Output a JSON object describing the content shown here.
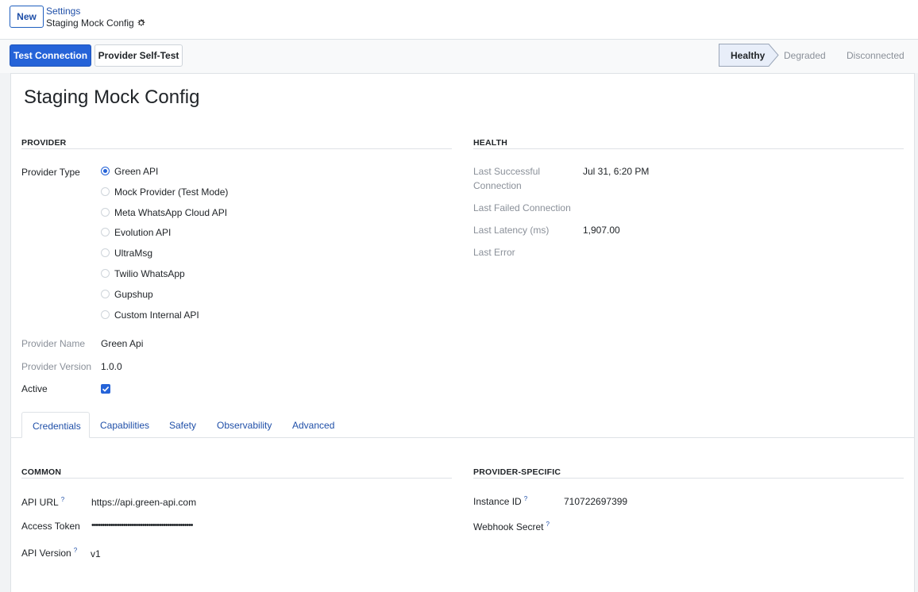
{
  "topbar": {
    "new_label": "New",
    "breadcrumb": "Settings",
    "record_name": "Staging Mock Config"
  },
  "actions": {
    "test_connection": "Test Connection",
    "self_test": "Provider Self-Test"
  },
  "status": {
    "stages": [
      "Healthy",
      "Degraded",
      "Disconnected"
    ],
    "current": "Healthy"
  },
  "form": {
    "title": "Staging Mock Config",
    "provider_section": "PROVIDER",
    "health_section": "HEALTH",
    "provider_type_label": "Provider Type",
    "provider_options": [
      "Green API",
      "Mock Provider (Test Mode)",
      "Meta WhatsApp Cloud API",
      "Evolution API",
      "UltraMsg",
      "Twilio WhatsApp",
      "Gupshup",
      "Custom Internal API"
    ],
    "selected_provider": "Green API",
    "provider_name_label": "Provider Name",
    "provider_name": "Green Api",
    "provider_version_label": "Provider Version",
    "provider_version": "1.0.0",
    "active_label": "Active",
    "active": true,
    "health": {
      "last_success_label_1": "Last Successful",
      "last_success_label_2": "Connection",
      "last_success": "Jul 31, 6:20 PM",
      "last_failed_label": "Last Failed Connection",
      "last_latency_label": "Last Latency (ms)",
      "last_latency": "1,907.00",
      "last_error_label": "Last Error"
    }
  },
  "tabs": [
    "Credentials",
    "Capabilities",
    "Safety",
    "Observability",
    "Advanced"
  ],
  "credentials": {
    "common_section": "COMMON",
    "specific_section": "PROVIDER-SPECIFIC",
    "api_url_label": "API URL",
    "api_url": "https://api.green-api.com",
    "access_token_label": "Access Token",
    "access_token": "••••••••••••••••••••••••••••••••••••••••••••••••",
    "api_version_label": "API Version",
    "api_version": "v1",
    "instance_id_label": "Instance ID",
    "instance_id": "710722697399",
    "webhook_secret_label": "Webhook Secret",
    "help_marker": "?"
  },
  "colors": {
    "primary": "#2563d8",
    "link": "#1f4fa8",
    "muted": "#8a9099"
  }
}
